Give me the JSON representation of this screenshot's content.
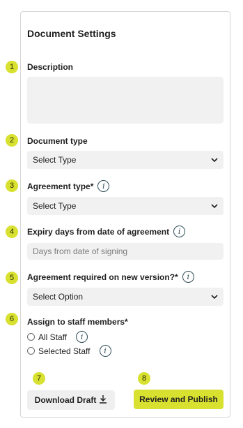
{
  "panel": {
    "title": "Document Settings"
  },
  "fields": {
    "description": {
      "step": "1",
      "label": "Description"
    },
    "document_type": {
      "step": "2",
      "label": "Document type",
      "selected": "Select Type"
    },
    "agreement_type": {
      "step": "3",
      "label": "Agreement type*",
      "selected": "Select Type"
    },
    "expiry_days": {
      "step": "4",
      "label": "Expiry days from date of agreement",
      "placeholder": "Days from date of signing"
    },
    "agreement_required": {
      "step": "5",
      "label": "Agreement required on new version?*",
      "selected": "Select Option"
    },
    "assign_staff": {
      "step": "6",
      "label": "Assign to staff members*",
      "options": [
        "All Staff",
        "Selected Staff"
      ]
    }
  },
  "actions": {
    "download": {
      "step": "7",
      "label": "Download Draft"
    },
    "publish": {
      "step": "8",
      "label": "Review and Publish"
    }
  },
  "colors": {
    "accent": "#d8e130",
    "input_bg": "#f1f1f1",
    "info_icon": "#2f4d57"
  },
  "icons": {
    "info": "info-icon",
    "chevron": "chevron-down-icon",
    "download": "download-icon"
  }
}
